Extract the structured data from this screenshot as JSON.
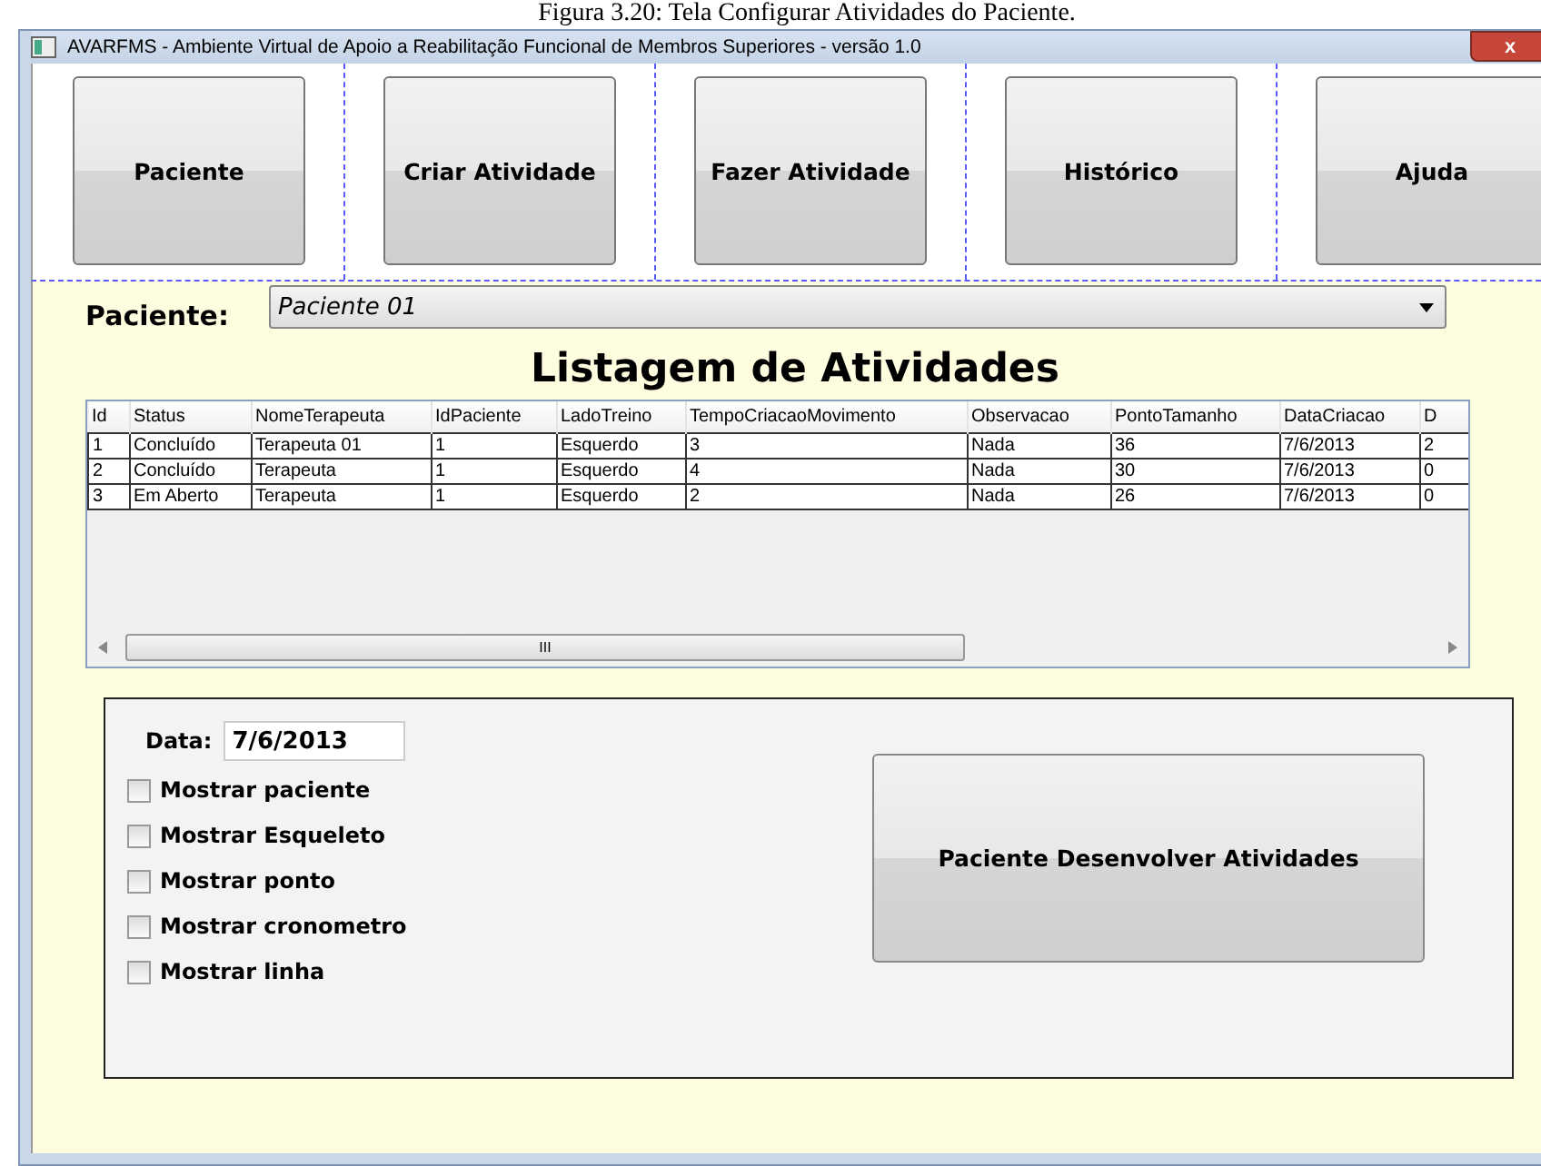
{
  "caption": "Figura 3.20: Tela Configurar Atividades do Paciente.",
  "window": {
    "title": "AVARFMS - Ambiente Virtual de Apoio a Reabilitação Funcional de Membros Superiores - versão 1.0",
    "close": "x"
  },
  "nav": [
    "Paciente",
    "Criar Atividade",
    "Fazer Atividade",
    "Histórico",
    "Ajuda"
  ],
  "patient": {
    "label": "Paciente:",
    "value": "Paciente 01"
  },
  "heading": "Listagem de Atividades",
  "table": {
    "columns": [
      "Id",
      "Status",
      "NomeTerapeuta",
      "IdPaciente",
      "LadoTreino",
      "TempoCriacaoMovimento",
      "Observacao",
      "PontoTamanho",
      "DataCriacao",
      "D"
    ],
    "rows": [
      [
        "1",
        "Concluído",
        "Terapeuta 01",
        "1",
        "Esquerdo",
        "3",
        "Nada",
        "36",
        "7/6/2013",
        "2"
      ],
      [
        "2",
        "Concluído",
        "Terapeuta",
        "1",
        "Esquerdo",
        "4",
        "Nada",
        "30",
        "7/6/2013",
        "0"
      ],
      [
        "3",
        "Em Aberto",
        "Terapeuta",
        "1",
        "Esquerdo",
        "2",
        "Nada",
        "26",
        "7/6/2013",
        "0"
      ]
    ],
    "scroll_mark": "III"
  },
  "date": {
    "label": "Data:",
    "value": "7/6/2013"
  },
  "options": [
    {
      "label": "Mostrar paciente",
      "checked": false
    },
    {
      "label": "Mostrar Esqueleto",
      "checked": false
    },
    {
      "label": "Mostrar ponto",
      "checked": false
    },
    {
      "label": "Mostrar cronometro",
      "checked": false
    },
    {
      "label": "Mostrar linha",
      "checked": false
    }
  ],
  "start_button": "Paciente Desenvolver Atividades"
}
